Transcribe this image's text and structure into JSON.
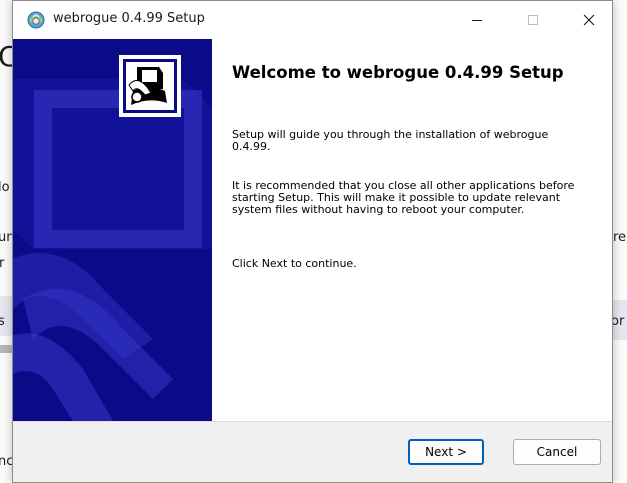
{
  "background": {
    "fragments": [
      "C",
      "lo",
      "un",
      "r",
      "s",
      "re",
      "or",
      "nc"
    ]
  },
  "window": {
    "title": "webrogue 0.4.99 Setup",
    "controls": {
      "minimize": "minimize",
      "maximize": "maximize",
      "close": "close"
    }
  },
  "welcome": {
    "heading": "Welcome to webrogue 0.4.99 Setup",
    "paragraphs": [
      "Setup will guide you through the installation of webrogue 0.4.99.",
      "It is recommended that you close all other applications before starting Setup. This will make it possible to update relevant system files without having to reboot your computer.",
      "Click Next to continue."
    ]
  },
  "buttons": {
    "next": "Next >",
    "cancel": "Cancel"
  },
  "colors": {
    "sidebar": "#0b0b8a",
    "accent": "#005fb8"
  }
}
